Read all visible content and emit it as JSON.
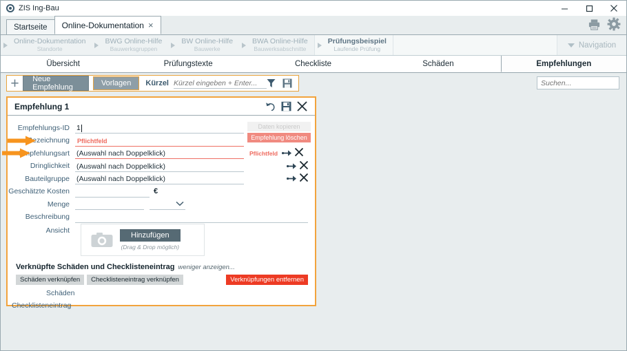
{
  "window": {
    "app_title": "ZIS Ing-Bau",
    "logo_icon": "circle-logo-icon",
    "minimize_label": "Minimieren",
    "maximize_label": "Maximieren",
    "close_label": "Schließen"
  },
  "tabs": [
    {
      "label": "Startseite",
      "active": false,
      "closable": false
    },
    {
      "label": "Online-Dokumentation",
      "active": true,
      "closable": true,
      "close_glyph": "×"
    }
  ],
  "header_icons": [
    {
      "name": "print-icon",
      "label": "Drucken"
    },
    {
      "name": "gear-icon",
      "label": "Einstellungen"
    }
  ],
  "breadcrumb": {
    "items": [
      {
        "main": "Online-Dokumentation",
        "sub": "Standorte",
        "current": false
      },
      {
        "main": "BWG Online-Hilfe",
        "sub": "Bauwerksgruppen",
        "current": false
      },
      {
        "main": "BW Online-Hilfe",
        "sub": "Bauwerke",
        "current": false
      },
      {
        "main": "BWA Online-Hilfe",
        "sub": "Bauwerksabschnitte",
        "current": false
      },
      {
        "main": "Prüfungsbeispiel",
        "sub": "Laufende Prüfung",
        "current": true
      }
    ],
    "navigation_label": "Navigation"
  },
  "section_tabs": [
    {
      "label": "Übersicht",
      "active": false
    },
    {
      "label": "Prüfungstexte",
      "active": false
    },
    {
      "label": "Checkliste",
      "active": false
    },
    {
      "label": "Schäden",
      "active": false
    },
    {
      "label": "Empfehlungen",
      "active": true
    }
  ],
  "toolbar": {
    "plus_glyph": "+",
    "new_button": "Neue Empfehlung",
    "templates_button": "Vorlagen",
    "kuerzel_label": "Kürzel",
    "kuerzel_placeholder": "Kürzel eingeben + Enter...",
    "kuerzel_value": "",
    "filter_icon": "filter-icon",
    "save_icon": "save-icon"
  },
  "search": {
    "placeholder": "Suchen...",
    "value": "",
    "icon": "search-icon"
  },
  "card": {
    "title": "Empfehlung 1",
    "icons": [
      {
        "name": "undo-icon",
        "label": "Rückgängig"
      },
      {
        "name": "save-icon",
        "label": "Speichern"
      },
      {
        "name": "close-icon",
        "label": "Schließen"
      }
    ],
    "side_buttons": {
      "copy_data": "Daten kopieren",
      "delete_recommendation": "Empfehlung löschen"
    },
    "fields": [
      {
        "label": "Empfehlungs-ID",
        "value": "1",
        "required": false,
        "error": "",
        "has_caret": true,
        "has_picker": false
      },
      {
        "label": "Bezeichnung",
        "value": "",
        "required": true,
        "error": "Pflichtfeld",
        "has_caret": false,
        "has_picker": false,
        "arrow": true
      },
      {
        "label": "Empfehlungsart",
        "value": "(Auswahl nach Doppelklick)",
        "required": true,
        "error": "Pflichtfeld",
        "has_caret": false,
        "has_picker": true,
        "arrow": true
      },
      {
        "label": "Dringlichkeit",
        "value": "(Auswahl nach Doppelklick)",
        "required": false,
        "error": "",
        "has_caret": false,
        "has_picker": true
      },
      {
        "label": "Bauteilgruppe",
        "value": "(Auswahl nach Doppelklick)",
        "required": false,
        "error": "",
        "has_caret": false,
        "has_picker": true
      }
    ],
    "cost": {
      "label": "Geschätzte Kosten",
      "value": "",
      "currency": "€"
    },
    "quantity": {
      "label": "Menge",
      "value": "",
      "unit_value": "",
      "unit_icon": "chevron-down-icon"
    },
    "description": {
      "label": "Beschreibung",
      "value": ""
    },
    "view": {
      "label": "Ansicht",
      "camera_icon": "camera-icon",
      "add_button": "Hinzufügen",
      "hint": "(Drag & Drop möglich)"
    },
    "linked": {
      "title": "Verknüpfte Schäden und Checklisteneintrag",
      "toggle": "weniger anzeigen...",
      "link_damage_button": "Schäden verknüpfen",
      "link_checklist_button": "Checklisteneintrag verknüpfen",
      "remove_links_button": "Verknüpfungen entfernen",
      "damage_label": "Schäden",
      "checklist_label": "Checklisteneintrag"
    }
  },
  "colors": {
    "accent_orange": "#f2a33c",
    "error_red": "#ee6a5e",
    "danger_red": "#ed3b24",
    "label_blue": "#3f6077",
    "toolbar_grey": "#7c8f99",
    "background": "#e8edee"
  }
}
